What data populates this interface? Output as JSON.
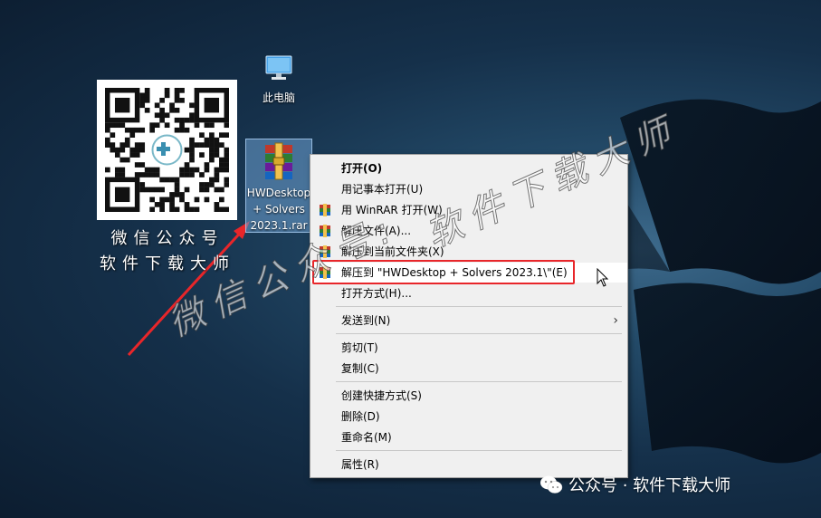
{
  "desktop": {
    "this_pc_label": "此电脑",
    "rar_file_label_lines": [
      "HWDesktop",
      "+ Solvers",
      "2023.1.rar"
    ]
  },
  "qr": {
    "caption_line1": "微信公众号",
    "caption_line2": "软件下载大师"
  },
  "context_menu": {
    "items": [
      {
        "label": "打开(O)"
      },
      {
        "label": "用记事本打开(U)"
      },
      {
        "label": "用 WinRAR 打开(W)"
      },
      {
        "label": "解压文件(A)..."
      },
      {
        "label": "解压到当前文件夹(X)"
      },
      {
        "label": "解压到 \"HWDesktop + Solvers 2023.1\\\"(E)"
      },
      {
        "label": "打开方式(H)..."
      },
      {
        "label": "发送到(N)"
      },
      {
        "label": "剪切(T)"
      },
      {
        "label": "复制(C)"
      },
      {
        "label": "创建快捷方式(S)"
      },
      {
        "label": "删除(D)"
      },
      {
        "label": "重命名(M)"
      },
      {
        "label": "属性(R)"
      }
    ]
  },
  "watermark": {
    "text1": "微信公众号:",
    "text2": "软件下载大师"
  },
  "footer": {
    "text": "公众号 · 软件下载大师"
  },
  "colors": {
    "highlight_box": "#e8262a",
    "menu_bg": "#f0f0f0"
  }
}
